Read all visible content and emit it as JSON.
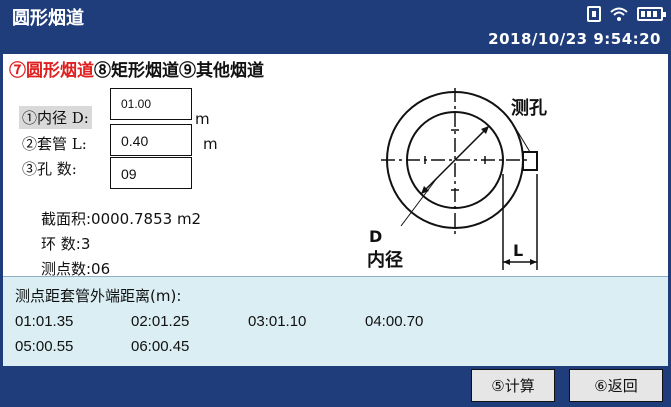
{
  "header": {
    "title": "圆形烟道",
    "datetime": "2018/10/23 9:54:20",
    "icons": [
      "usb-icon",
      "wifi-icon",
      "battery-icon"
    ]
  },
  "tabs": [
    {
      "label": "⑦圆形烟道",
      "active": true
    },
    {
      "label": "⑧矩形烟道",
      "active": false
    },
    {
      "label": "⑨其他烟道",
      "active": false
    }
  ],
  "fields": {
    "inner_diameter": {
      "label": "①内径 D:",
      "value": "01.00",
      "unit": "m"
    },
    "sleeve": {
      "label": "②套管 L:",
      "value": "0.40",
      "unit": "m"
    },
    "holes": {
      "label": "③孔  数:",
      "value": "09"
    }
  },
  "results": {
    "area": "截面积:0000.7853 m2",
    "rings": "环    数:3",
    "points": "测点数:06"
  },
  "diagram": {
    "hole_label": "测孔",
    "d_label": "D",
    "diameter_label": "内径",
    "l_label": "L"
  },
  "distances": {
    "title": "测点距套管外端距离(m):",
    "items": [
      "01:01.35",
      "02:01.25",
      "03:01.10",
      "04:00.70",
      "05:00.55",
      "06:00.45"
    ]
  },
  "buttons": {
    "calculate": "⑤计算",
    "back": "⑥返回"
  },
  "colors": {
    "header_bg": "#1f3d7a",
    "active_tab": "#e02020",
    "distance_panel_bg": "#daeef3"
  }
}
